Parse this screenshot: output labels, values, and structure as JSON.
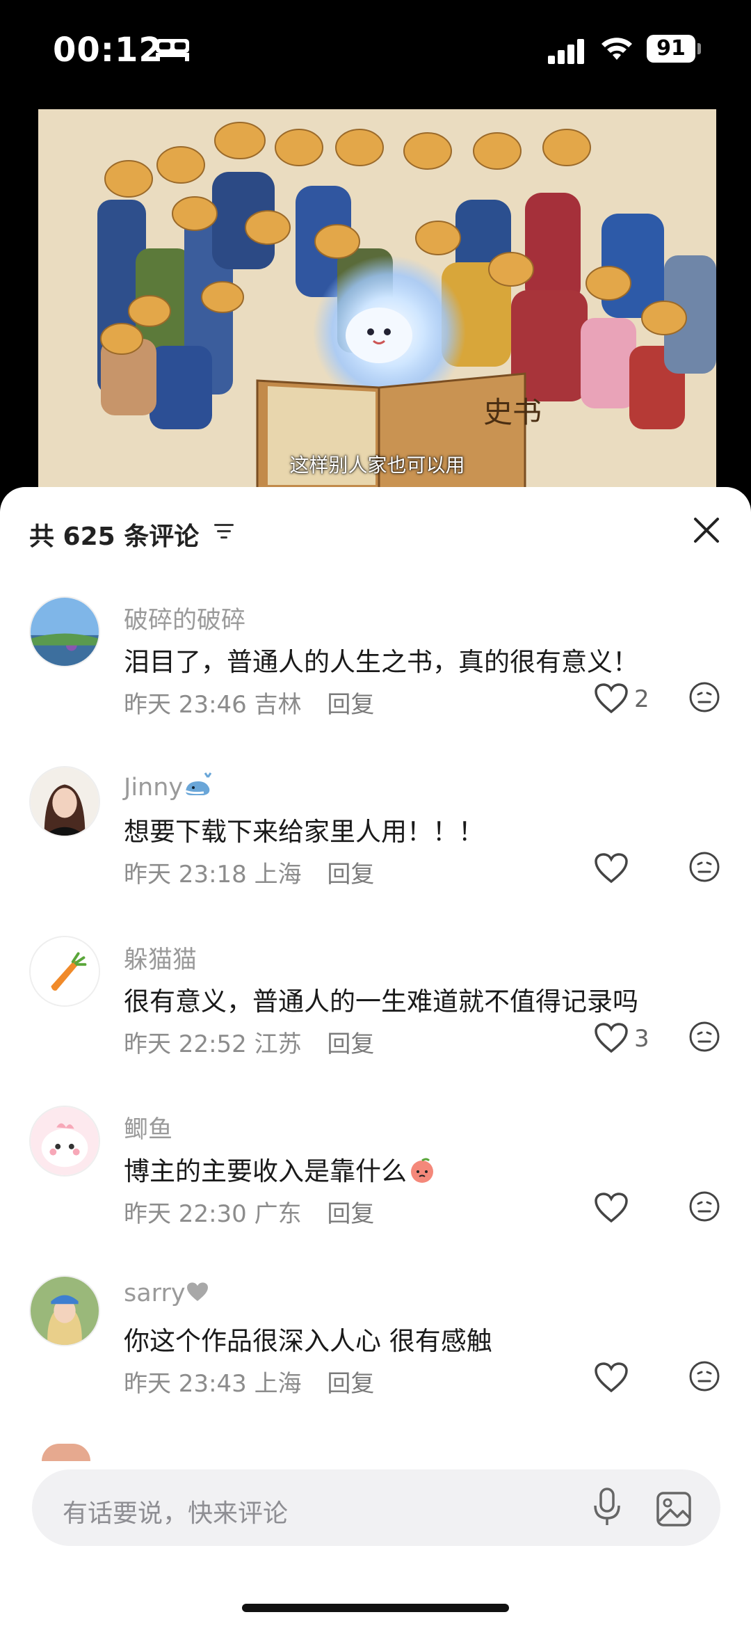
{
  "status_bar": {
    "time": "00:12",
    "battery": "91"
  },
  "video": {
    "subtitle": "这样别人家也可以用",
    "book_title": "史书"
  },
  "comments_header": {
    "count_label": "共 625 条评论"
  },
  "comments": [
    {
      "user": "破碎的破碎",
      "text": "泪目了，普通人的人生之书，真的很有意义！",
      "time": "昨天 23:46",
      "location": "吉林",
      "reply_label": "回复",
      "likes": "2"
    },
    {
      "user": "Jinny",
      "text": "想要下载下来给家里人用！！！",
      "time": "昨天 23:18",
      "location": "上海",
      "reply_label": "回复",
      "likes": ""
    },
    {
      "user": "躲猫猫",
      "text": "很有意义，普通人的一生难道就不值得记录吗",
      "time": "昨天 22:52",
      "location": "江苏",
      "reply_label": "回复",
      "likes": "3"
    },
    {
      "user": "鲫鱼",
      "text": "博主的主要收入是靠什么",
      "time": "昨天 22:30",
      "location": "广东",
      "reply_label": "回复",
      "likes": ""
    },
    {
      "user": "sarry",
      "text": "你这个作品很深入人心 很有感触",
      "time": "昨天 23:43",
      "location": "上海",
      "reply_label": "回复",
      "likes": ""
    }
  ],
  "input": {
    "placeholder": "有话要说，快来评论"
  },
  "icons": [
    "bed-icon",
    "signal-icon",
    "wifi-icon",
    "sort-icon",
    "close-icon",
    "heart-icon",
    "dislike-face-icon",
    "mic-icon",
    "image-icon",
    "whale-emoji",
    "heart-emoji",
    "peach-emoji"
  ]
}
